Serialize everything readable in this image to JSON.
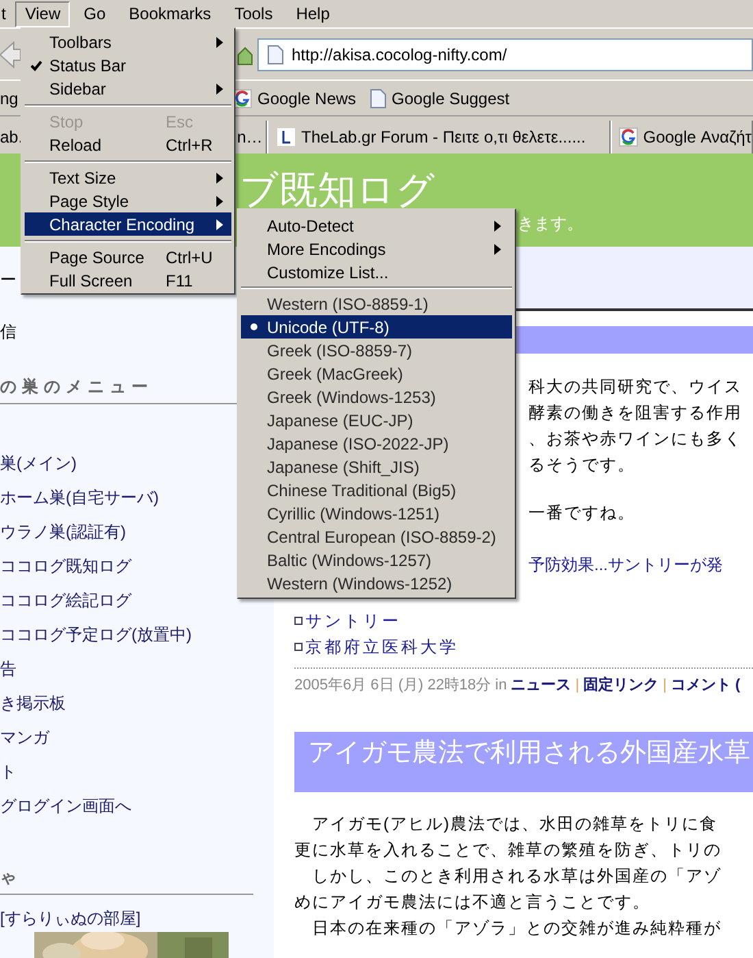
{
  "menubar": [
    {
      "label": "t",
      "selected": false
    },
    {
      "label": "View",
      "selected": true
    },
    {
      "label": "Go",
      "selected": false
    },
    {
      "label": "Bookmarks",
      "selected": false
    },
    {
      "label": "Tools",
      "selected": false
    },
    {
      "label": "Help",
      "selected": false
    }
  ],
  "toolbar": {
    "url": "http://akisa.cocolog-nifty.com/"
  },
  "bookmarks": [
    {
      "label": "ng",
      "kind": "plain"
    },
    {
      "label": "Google News",
      "kind": "google"
    },
    {
      "label": "Google Suggest",
      "kind": "page"
    }
  ],
  "tabs": [
    {
      "label": "ab.",
      "kind": "plain"
    },
    {
      "label": "n…",
      "kind": "plain"
    },
    {
      "label": "TheLab.gr Forum - Πειτε ο,τι θελετε......",
      "kind": "lab"
    },
    {
      "label": "Google Αναζήτ",
      "kind": "google"
    }
  ],
  "header": {
    "title": "ブ既知ログ",
    "subtitle": "きます。"
  },
  "sidebar": {
    "top_items": [
      "ー",
      "信"
    ],
    "sections": [
      {
        "heading": "の巣のメニュー",
        "items": [
          {
            "text": "巣(メイン)",
            "kind": "link"
          },
          {
            "text": "ホーム巣(自宅サーバ)",
            "kind": "link"
          },
          {
            "text": "ウラノ巣(認証有)",
            "kind": "link"
          },
          {
            "text": "ココログ既知ログ",
            "kind": "link"
          },
          {
            "text": "ココログ絵記ログ",
            "kind": "link"
          },
          {
            "text": "ココログ予定ログ(放置中)",
            "kind": "link"
          },
          {
            "text": "告",
            "kind": "link"
          },
          {
            "text": "き掲示板",
            "kind": "link"
          },
          {
            "text": "マンガ",
            "kind": "link"
          },
          {
            "text": "ト",
            "kind": "link"
          },
          {
            "text": "グログイン画面へ",
            "kind": "link"
          }
        ]
      },
      {
        "heading": "ゃ",
        "items": [
          {
            "text": "[すらりぃぬの部屋]",
            "kind": "link"
          },
          {
            "kind": "picture"
          }
        ]
      }
    ]
  },
  "article": {
    "top_lines": [
      "科大の共同研究で、ウイス",
      "酵素の働きを阻害する作用",
      "、お茶や赤ワインにも多く",
      "るそうです。"
    ],
    "after_line": "一番ですね。",
    "link_line": "予防効果...サントリーが発",
    "related": [
      {
        "text": "サントリー",
        "kind": "link"
      },
      {
        "text": "京都府立医科大学",
        "kind": "link"
      }
    ],
    "meta": [
      {
        "text": "2005年6月 6日 (月) 22時18分",
        "kind": "text"
      },
      {
        "text": "in",
        "kind": "text"
      },
      {
        "text": "ニュース",
        "kind": "link"
      },
      {
        "text": "|",
        "kind": "sep"
      },
      {
        "text": "固定リンク",
        "kind": "link"
      },
      {
        "text": "|",
        "kind": "sep"
      },
      {
        "text": "コメント (",
        "kind": "link"
      }
    ],
    "next_title": "アイガモ農法で利用される外国産水草",
    "paragraph": [
      "　アイガモ(アヒル)農法では、水田の雑草をトリに食",
      "更に水草を入れることで、雑草の繁殖を防ぎ、トリの",
      "　しかし、このとき利用される水草は外国産の「アゾ",
      "めにアイガモ農法には不適と言うことです。",
      "　日本の在来種の「アゾラ」との交雑が進み純粋種が"
    ]
  },
  "view_menu": [
    {
      "kind": "item",
      "label": "Toolbars",
      "submenu": true,
      "checked": false,
      "disabled": false,
      "highlighted": false
    },
    {
      "kind": "item",
      "label": "Status Bar",
      "submenu": false,
      "checked": true,
      "disabled": false,
      "highlighted": false
    },
    {
      "kind": "item",
      "label": "Sidebar",
      "submenu": true,
      "checked": false,
      "disabled": false,
      "highlighted": false
    },
    {
      "kind": "separator"
    },
    {
      "kind": "item",
      "label": "Stop",
      "shortcut": "Esc",
      "submenu": false,
      "checked": false,
      "disabled": true,
      "highlighted": false
    },
    {
      "kind": "item",
      "label": "Reload",
      "shortcut": "Ctrl+R",
      "submenu": false,
      "checked": false,
      "disabled": false,
      "highlighted": false
    },
    {
      "kind": "separator"
    },
    {
      "kind": "item",
      "label": "Text Size",
      "submenu": true,
      "checked": false,
      "disabled": false,
      "highlighted": false
    },
    {
      "kind": "item",
      "label": "Page Style",
      "submenu": true,
      "checked": false,
      "disabled": false,
      "highlighted": false
    },
    {
      "kind": "item",
      "label": "Character Encoding",
      "submenu": true,
      "checked": false,
      "disabled": false,
      "highlighted": true
    },
    {
      "kind": "separator"
    },
    {
      "kind": "item",
      "label": "Page Source",
      "shortcut": "Ctrl+U",
      "submenu": false,
      "checked": false,
      "disabled": false,
      "highlighted": false
    },
    {
      "kind": "item",
      "label": "Full Screen",
      "shortcut": "F11",
      "submenu": false,
      "checked": false,
      "disabled": false,
      "highlighted": false
    }
  ],
  "encoding_menu": [
    {
      "kind": "item",
      "label": "Auto-Detect",
      "submenu": true
    },
    {
      "kind": "item",
      "label": "More Encodings",
      "submenu": true
    },
    {
      "kind": "item",
      "label": "Customize List...",
      "submenu": false
    },
    {
      "kind": "separator"
    },
    {
      "kind": "radio",
      "label": "Western (ISO-8859-1)",
      "selected": false
    },
    {
      "kind": "radio",
      "label": "Unicode (UTF-8)",
      "selected": true
    },
    {
      "kind": "radio",
      "label": "Greek (ISO-8859-7)",
      "selected": false
    },
    {
      "kind": "radio",
      "label": "Greek (MacGreek)",
      "selected": false
    },
    {
      "kind": "radio",
      "label": "Greek (Windows-1253)",
      "selected": false
    },
    {
      "kind": "radio",
      "label": "Japanese (EUC-JP)",
      "selected": false
    },
    {
      "kind": "radio",
      "label": "Japanese (ISO-2022-JP)",
      "selected": false
    },
    {
      "kind": "radio",
      "label": "Japanese (Shift_JIS)",
      "selected": false
    },
    {
      "kind": "radio",
      "label": "Chinese Traditional (Big5)",
      "selected": false
    },
    {
      "kind": "radio",
      "label": "Cyrillic (Windows-1251)",
      "selected": false
    },
    {
      "kind": "radio",
      "label": "Central European (ISO-8859-2)",
      "selected": false
    },
    {
      "kind": "radio",
      "label": "Baltic (Windows-1257)",
      "selected": false
    },
    {
      "kind": "radio",
      "label": "Western (Windows-1252)",
      "selected": false
    }
  ]
}
